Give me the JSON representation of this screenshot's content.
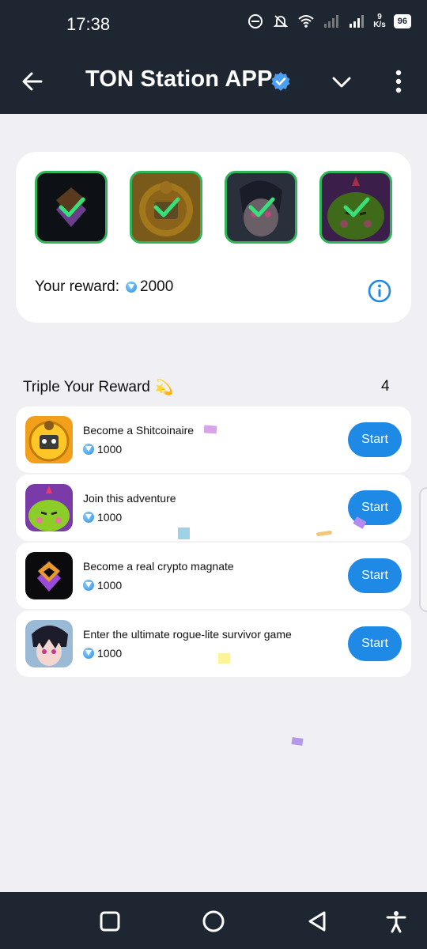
{
  "status_bar": {
    "time": "17:38",
    "speed_value": "9",
    "speed_unit": "K/s",
    "battery": "96"
  },
  "header": {
    "title": "TON Station APP",
    "back_icon": "arrow-left-icon",
    "verified_icon": "verified-badge-icon",
    "dropdown_icon": "chevron-down-icon",
    "more_icon": "more-vertical-icon"
  },
  "reward_card": {
    "badges": [
      {
        "name": "crypto-magnate-badge",
        "completed": true
      },
      {
        "name": "shitcoinaire-badge",
        "completed": true
      },
      {
        "name": "rogue-lite-badge",
        "completed": true
      },
      {
        "name": "adventure-badge",
        "completed": true
      }
    ],
    "reward_label": "Your reward:",
    "reward_value": "2000"
  },
  "section": {
    "title": "Triple Your Reward",
    "emoji": "💫",
    "count": "4"
  },
  "tasks": [
    {
      "title": "Become a Shitcoinaire",
      "reward": "1000",
      "button": "Start"
    },
    {
      "title": "Join this adventure",
      "reward": "1000",
      "button": "Start"
    },
    {
      "title": "Become a real crypto magnate",
      "reward": "1000",
      "button": "Start"
    },
    {
      "title": "Enter the ultimate rogue-lite survivor game",
      "reward": "1000",
      "button": "Start"
    }
  ],
  "colors": {
    "header_bg": "#1e2632",
    "accent": "#1e8ae6",
    "check_green": "#2fb457",
    "page_bg": "#efeff4"
  }
}
